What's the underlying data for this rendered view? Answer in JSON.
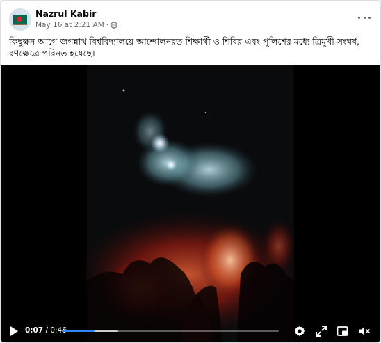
{
  "post": {
    "author": "Nazrul Kabir",
    "date": "May 16 at 2:21 AM",
    "separator": "·",
    "caption": "কিছুক্ষন আগে জগন্নাথ বিশ্ববিদ্যালয়ে আন্দোলনরত শিক্ষার্থী ও শিবির এবং পুলিশের মধ্যে ত্রিমুখী সংঘর্ষ, রণক্ষেত্রে পরিনত হয়েছে।"
  },
  "video": {
    "current_time": "0:07",
    "time_separator": " / ",
    "duration": "0:46",
    "progress_fraction": 0.152,
    "buffered_fraction": 0.26
  },
  "colors": {
    "accent": "#2d88ff",
    "card_bg": "#ffffff",
    "page_bg": "#f0f2f5",
    "muted_text": "#65676b",
    "video_bg": "#000000"
  },
  "icons": {
    "privacy": "globe-icon",
    "menu": "more-options-icon",
    "play": "play-icon",
    "settings": "gear-icon",
    "fullscreen": "expand-icon",
    "pip": "picture-in-picture-icon",
    "volume": "volume-icon"
  }
}
